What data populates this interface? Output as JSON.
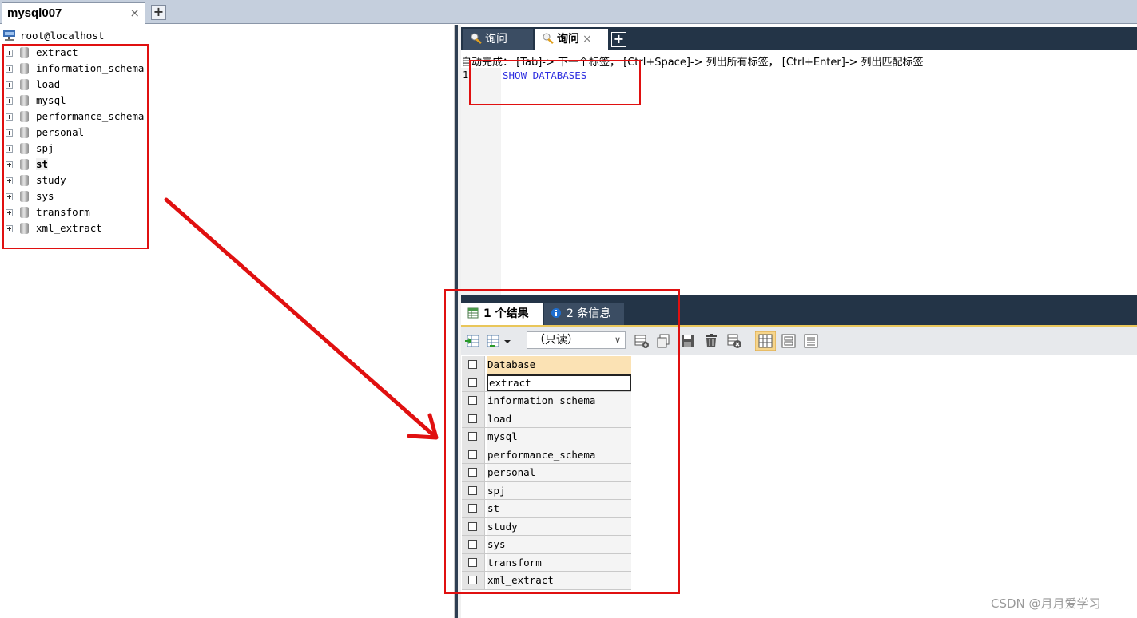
{
  "connection_tab": {
    "title": "mysql007",
    "close_glyph": "×",
    "add_glyph": "+"
  },
  "object_browser": {
    "root": "root@localhost",
    "databases": [
      "extract",
      "information_schema",
      "load",
      "mysql",
      "performance_schema",
      "personal",
      "spj",
      "st",
      "study",
      "sys",
      "transform",
      "xml_extract"
    ],
    "bold_database": "st"
  },
  "query_tabs": {
    "tabs": [
      {
        "label": "询问",
        "icon": "query-icon"
      },
      {
        "label": "询问",
        "icon": "query-icon",
        "close": "×"
      }
    ],
    "add_glyph": "+"
  },
  "editor": {
    "hint": "自动完成： [Tab]-> 下一个标签， [Ctrl+Space]-> 列出所有标签， [Ctrl+Enter]-> 列出匹配标签",
    "line_number": "1",
    "sql": "SHOW DATABASES"
  },
  "result_tabs": {
    "results_label": "1 个结果",
    "messages_label": "2 条信息"
  },
  "result_toolbar": {
    "mode": "（只读）",
    "dropdown_arrow": "∨"
  },
  "result_grid": {
    "column": "Database",
    "rows": [
      "extract",
      "information_schema",
      "load",
      "mysql",
      "performance_schema",
      "personal",
      "spj",
      "st",
      "study",
      "sys",
      "transform",
      "xml_extract"
    ]
  },
  "watermark": "CSDN @月月爱学习",
  "colors": {
    "annotation": "#e01010",
    "sql_keyword": "#3030e0",
    "dark_chrome": "#233447"
  }
}
